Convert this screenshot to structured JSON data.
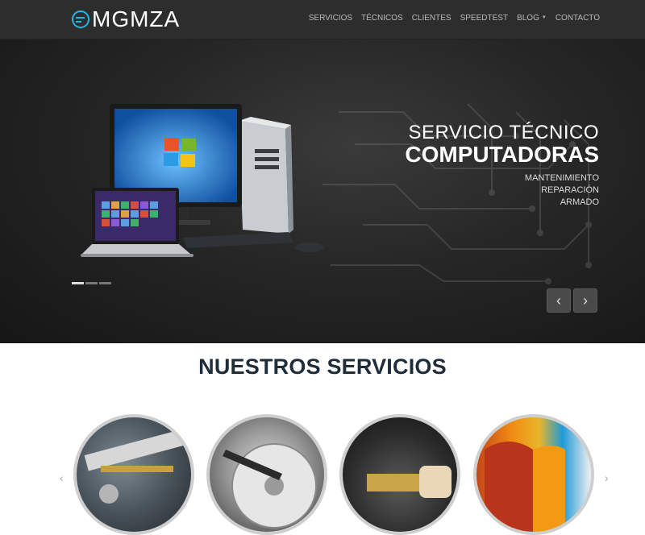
{
  "brand": {
    "name": "MGMZA",
    "icon": "logo-ring-icon"
  },
  "nav": {
    "items": [
      {
        "label": "SERVICIOS"
      },
      {
        "label": "TÉCNICOS"
      },
      {
        "label": "CLIENTES"
      },
      {
        "label": "SPEEDTEST"
      },
      {
        "label": "BLOG",
        "has_dropdown": true
      },
      {
        "label": "CONTACTO"
      }
    ]
  },
  "hero": {
    "title_line1": "SERVICIO TÉCNICO",
    "title_line2": "COMPUTADORAS",
    "subtitles": [
      "MANTENIMIENTO",
      "REPARACIÓN",
      "ARMADO"
    ],
    "prev_icon": "chevron-left-icon",
    "next_icon": "chevron-right-icon",
    "prev_glyph": "‹",
    "next_glyph": "›",
    "slides": 3,
    "active_slide": 1
  },
  "section": {
    "title": "NUESTROS SERVICIOS"
  },
  "services": [
    {
      "icon": "engine-repair-image"
    },
    {
      "icon": "hard-drive-image"
    },
    {
      "icon": "network-cable-image"
    },
    {
      "icon": "windows-logo-image"
    }
  ],
  "colors": {
    "accent": "#22b5e6",
    "nav_bg": "#2d2d2d",
    "title": "#1f2d3a"
  }
}
